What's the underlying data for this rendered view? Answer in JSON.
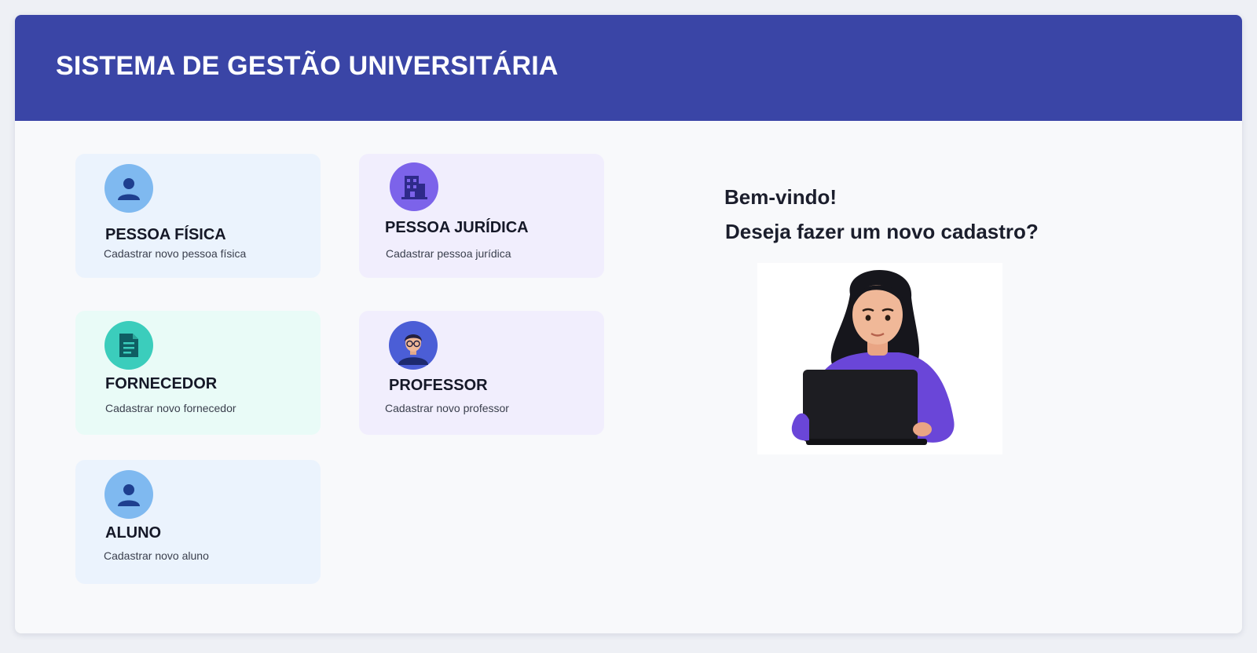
{
  "header": {
    "title": "SISTEMA DE GESTÃO UNIVERSITÁRIA"
  },
  "cards": [
    {
      "title": "PESSOA FÍSICA",
      "description": "Cadastrar novo pessoa física",
      "icon": "person-icon",
      "bg": "#ebf3fd",
      "icon_bg": "#7fb9f0"
    },
    {
      "title": "PESSOA JURÍDICA",
      "description": "Cadastrar pessoa jurídica",
      "icon": "building-icon",
      "bg": "#f1eefd",
      "icon_bg": "#7c63ea"
    },
    {
      "title": "FORNECEDOR",
      "description": "Cadastrar novo fornecedor",
      "icon": "document-icon",
      "bg": "#e9fbf7",
      "icon_bg": "#3bcdbc"
    },
    {
      "title": "PROFESSOR",
      "description": "Cadastrar novo professor",
      "icon": "teacher-icon",
      "bg": "#f1eefd",
      "icon_bg": "#4b5ed6"
    },
    {
      "title": "ALUNO",
      "description": "Cadastrar novo aluno",
      "icon": "person-icon",
      "bg": "#ebf3fd",
      "icon_bg": "#7fb9f0"
    }
  ],
  "welcome": {
    "line1": "Bem-vindo!",
    "line2": "Deseja fazer um novo cadastro?"
  },
  "illustration": {
    "icon": "woman-with-laptop-illustration"
  },
  "colors": {
    "header": "#3a45a6",
    "page_bg": "#f8f9fb"
  }
}
